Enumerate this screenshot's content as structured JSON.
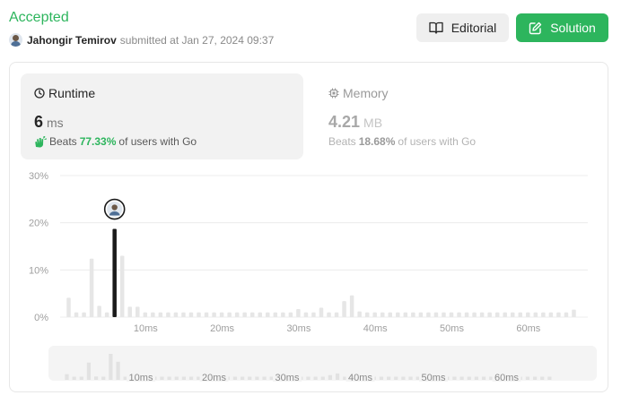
{
  "header": {
    "status": "Accepted",
    "username": "Jahongir Temirov",
    "submitted_text": "submitted at Jan 27, 2024 09:37"
  },
  "buttons": {
    "editorial": "Editorial",
    "solution": "Solution"
  },
  "runtime": {
    "title": "Runtime",
    "value": "6",
    "unit": "ms",
    "beats_label": "Beats",
    "beats_pct": "77.33%",
    "beats_suffix": "of users with Go"
  },
  "memory": {
    "title": "Memory",
    "value": "4.21",
    "unit": "MB",
    "beats_label": "Beats",
    "beats_pct": "18.68%",
    "beats_suffix": "of users with Go"
  },
  "colors": {
    "accent": "#2db55d",
    "bar": "#e6e6e6",
    "highlight_bar": "#1a1a1a"
  },
  "chart_data": {
    "type": "bar",
    "ylim": [
      0,
      30
    ],
    "yticks": [
      "30%",
      "20%",
      "10%",
      "0%"
    ],
    "ytick_values": [
      30,
      20,
      10,
      0
    ],
    "x": [
      1,
      2,
      3,
      4,
      5,
      6,
      7,
      8,
      9,
      10,
      11,
      12,
      13,
      14,
      15,
      16,
      17,
      18,
      19,
      20,
      21,
      22,
      23,
      24,
      25,
      26,
      27,
      28,
      29,
      30,
      31,
      32,
      33,
      34,
      35,
      36,
      37,
      38,
      39,
      40,
      41,
      42,
      43,
      44,
      45,
      46,
      47,
      48,
      49,
      50,
      51,
      52,
      53,
      54,
      55,
      56,
      57,
      58,
      59,
      60,
      61,
      62,
      63,
      64,
      65,
      66,
      67
    ],
    "values": [
      4.1,
      1,
      1,
      12.4,
      2.4,
      1,
      18.7,
      13,
      2.2,
      2.2,
      1,
      1,
      1,
      1,
      1,
      1,
      1,
      1,
      1,
      1,
      1,
      1,
      1,
      1,
      1,
      1,
      1,
      1,
      1,
      1,
      1.7,
      1,
      1,
      2,
      1,
      1,
      3.4,
      4.6,
      1.2,
      1,
      1,
      1,
      1,
      1,
      1,
      1,
      1,
      1,
      1,
      1,
      1,
      1,
      1,
      1,
      1,
      1,
      1,
      1,
      1,
      1,
      1,
      1,
      1,
      1,
      1,
      1,
      1.6
    ],
    "highlight_x": 7,
    "xticks": [
      "10ms",
      "20ms",
      "30ms",
      "40ms",
      "50ms",
      "60ms"
    ],
    "xtick_values": [
      11,
      21,
      31,
      41,
      51,
      61
    ],
    "grid": true
  },
  "brush": {
    "xticks": [
      "10ms",
      "20ms",
      "30ms",
      "40ms",
      "50ms",
      "60ms"
    ]
  }
}
